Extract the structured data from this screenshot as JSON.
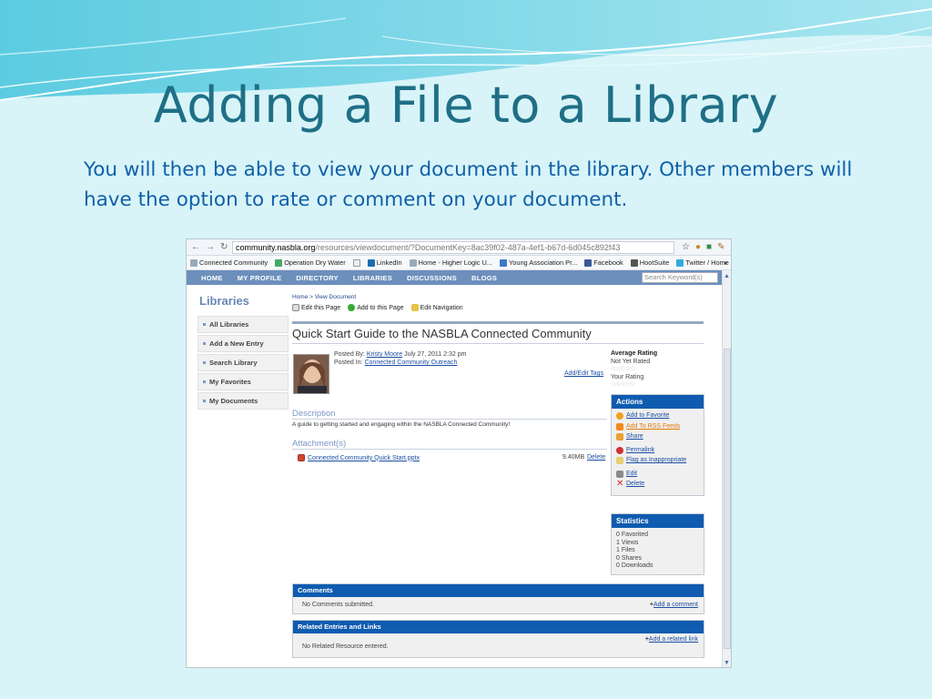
{
  "slide": {
    "title": "Adding a File to a Library",
    "body": "You will then be able to view your document in the library. Other members will have the option to rate or comment on your document."
  },
  "browser": {
    "url_host": "community.nasbla.org",
    "url_path": "/resources/viewdocument/?DocumentKey=8ac39f02-487a-4ef1-b67d-6d045c892f43",
    "bookmarks": [
      "Connected Community",
      "Operation Dry Water",
      "LinkedIn",
      "Home - Higher Logic U...",
      "Young Association Pr...",
      "Facebook",
      "HootSuite",
      "Twitter / Home"
    ],
    "overflow": "»"
  },
  "site_nav": {
    "items": [
      "HOME",
      "MY PROFILE",
      "DIRECTORY",
      "LIBRARIES",
      "DISCUSSIONS",
      "BLOGS"
    ],
    "search_placeholder": "Search Keyword(s)"
  },
  "sidebar": {
    "title": "Libraries",
    "items": [
      "All Libraries",
      "Add a New Entry",
      "Search Library",
      "My Favorites",
      "My Documents"
    ]
  },
  "page": {
    "breadcrumb": "Home > View Document",
    "toolbar": [
      "Edit this Page",
      "Add to this Page",
      "Edit Navigation"
    ],
    "doc_title": "Quick Start Guide to the NASBLA Connected Community",
    "posted_by_label": "Posted By:",
    "author": "Kristy Moore",
    "date": "July 27, 2011 2:32 pm",
    "posted_in_label": "Posted In:",
    "posted_in": "Connected Community Outreach",
    "tags_link": "Add/Edit Tags",
    "description_heading": "Description",
    "description": "A guide to getting started and engaging within the NASBLA Connected Community!",
    "attachments_heading": "Attachment(s)",
    "attachment_name": "Connected Community Quick Start.pptx",
    "attachment_size": "9.40MB",
    "attachment_delete": "Delete"
  },
  "rating": {
    "average_label": "Average Rating",
    "average_value": "Not Yet Rated",
    "your_label": "Your Rating",
    "stars": 5
  },
  "actions": {
    "title": "Actions",
    "items": [
      "Add to Favorite",
      "Add To RSS Feeds",
      "Share",
      "Permalink",
      "Flag as Inappropriate",
      "Edit",
      "Delete"
    ]
  },
  "statistics": {
    "title": "Statistics",
    "items": [
      "0 Favorited",
      "1 Views",
      "1 Files",
      "0 Shares",
      "0 Downloads"
    ]
  },
  "comments": {
    "title": "Comments",
    "empty": "No Comments submitted.",
    "add": "Add a comment"
  },
  "related": {
    "title": "Related Entries and Links",
    "empty": "No Related Resource entered.",
    "add": "Add a related link"
  },
  "colors": {
    "title": "#1f6f86",
    "body": "#1060a8",
    "header_blue": "#0f5bb0",
    "nav_blue": "#6c8fbc",
    "link": "#1b4ea3"
  }
}
